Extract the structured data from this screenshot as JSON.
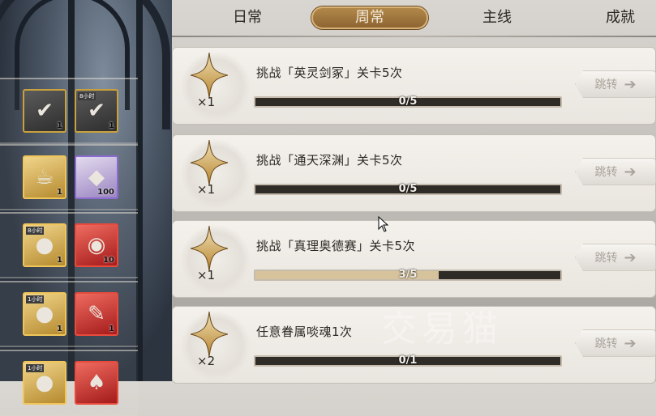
{
  "tabs": [
    {
      "label": "日常"
    },
    {
      "label": "周常"
    },
    {
      "label": "主线"
    },
    {
      "label": "成就"
    }
  ],
  "active_tab": "周常",
  "rewards": [
    [
      {
        "icon": "ticket-check-icon",
        "qty": "1",
        "tier": "gray",
        "tag": ""
      },
      {
        "icon": "ticket-check-icon",
        "qty": "1",
        "tier": "gray",
        "tag": "8小时"
      }
    ],
    [
      {
        "icon": "teapot-icon",
        "qty": "1",
        "tier": "gold",
        "tag": ""
      },
      {
        "icon": "ore-icon",
        "qty": "100",
        "tier": "purple",
        "tag": ""
      }
    ],
    [
      {
        "icon": "coins-icon",
        "qty": "1",
        "tier": "gold",
        "tag": "8小时"
      },
      {
        "icon": "mirror-icon",
        "qty": "10",
        "tier": "red",
        "tag": ""
      }
    ],
    [
      {
        "icon": "coins-icon",
        "qty": "1",
        "tier": "gold",
        "tag": "1小时"
      },
      {
        "icon": "scroll-icon",
        "qty": "1",
        "tier": "red",
        "tag": ""
      }
    ],
    [
      {
        "icon": "coins-icon",
        "qty": "",
        "tier": "gold",
        "tag": "1小时"
      },
      {
        "icon": "card-icon",
        "qty": "",
        "tier": "red",
        "tag": ""
      }
    ]
  ],
  "quests": [
    {
      "title": "挑战「英灵剑冢」关卡5次",
      "reward_qty": "×1",
      "progress_text": "0/5",
      "current": 0,
      "total": 5,
      "jump_label": "跳转"
    },
    {
      "title": "挑战「通天深渊」关卡5次",
      "reward_qty": "×1",
      "progress_text": "0/5",
      "current": 0,
      "total": 5,
      "jump_label": "跳转"
    },
    {
      "title": "挑战「真理奥德赛」关卡5次",
      "reward_qty": "×1",
      "progress_text": "3/5",
      "current": 3,
      "total": 5,
      "jump_label": "跳转"
    },
    {
      "title": "任意眷属啖魂1次",
      "reward_qty": "×2",
      "progress_text": "0/1",
      "current": 0,
      "total": 1,
      "jump_label": "跳转"
    }
  ],
  "watermark": "交易猫",
  "colors": {
    "tab_active": "#9c7238",
    "bar_track": "#2f2b27",
    "bar_fill": "#d7c39b"
  }
}
